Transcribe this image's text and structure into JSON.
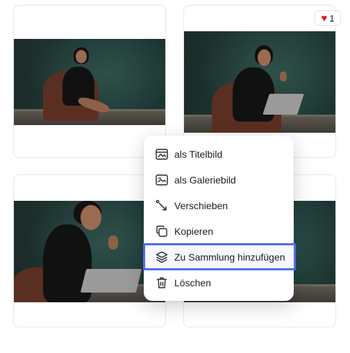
{
  "gallery": {
    "cards": [
      {
        "id": "card-1"
      },
      {
        "id": "card-2",
        "likes": "1"
      },
      {
        "id": "card-3"
      },
      {
        "id": "card-4"
      }
    ]
  },
  "context_menu": {
    "items": [
      {
        "label": "als Titelbild",
        "icon": "cover-image-icon"
      },
      {
        "label": "als Galeriebild",
        "icon": "gallery-image-icon"
      },
      {
        "label": "Verschieben",
        "icon": "move-icon"
      },
      {
        "label": "Kopieren",
        "icon": "copy-icon"
      },
      {
        "label": "Zu Sammlung hinzufügen",
        "icon": "layers-icon",
        "focused": true
      },
      {
        "label": "Löschen",
        "icon": "trash-icon"
      }
    ]
  },
  "colors": {
    "focus_ring": "#4a6cf0",
    "heart": "#d62020"
  }
}
